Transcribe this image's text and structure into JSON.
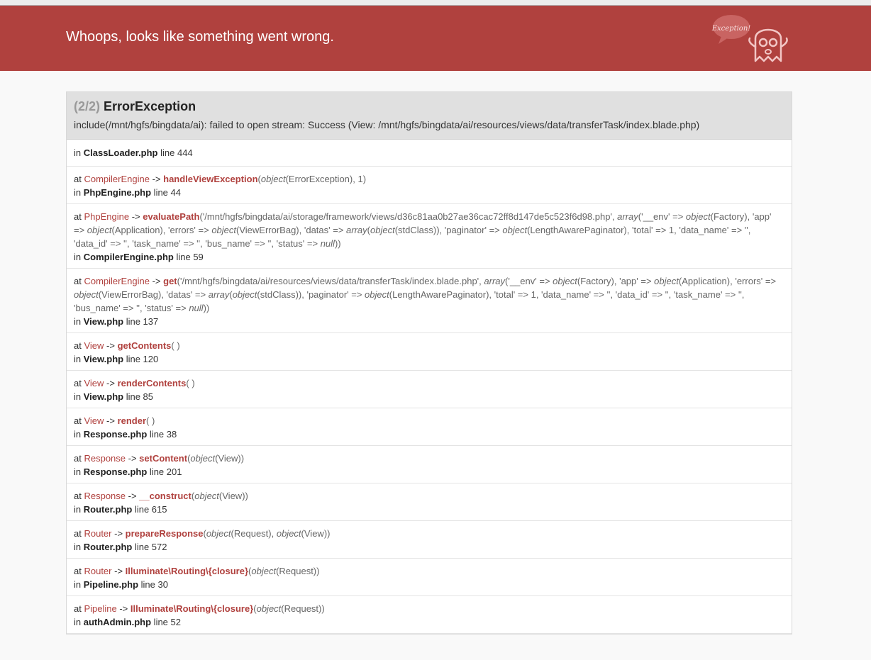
{
  "header": {
    "title": "Whoops, looks like something went wrong.",
    "logo_text": "Exception!"
  },
  "exception": {
    "count": "(2/2)",
    "name": "ErrorException",
    "message": "include(/mnt/hgfs/bingdata/ai): failed to open stream: Success (View: /mnt/hgfs/bingdata/ai/resources/views/data/transferTask/index.blade.php)"
  },
  "first_frame": {
    "prefix": "in",
    "file": "ClassLoader.php",
    "line_text": "line 444"
  },
  "frames": [
    {
      "class": "CompilerEngine",
      "method": "handleViewException",
      "args": [
        [
          "object",
          "(ErrorException)"
        ],
        [
          "",
          ", 1"
        ]
      ],
      "file": "PhpEngine.php",
      "line_text": "line 44"
    },
    {
      "class": "PhpEngine",
      "method": "evaluatePath",
      "args_html_key": "eval",
      "file": "CompilerEngine.php",
      "line_text": "line 59"
    },
    {
      "class": "CompilerEngine",
      "method": "get",
      "args_html_key": "get",
      "file": "View.php",
      "line_text": "line 137"
    },
    {
      "class": "View",
      "method": "getContents",
      "args": [],
      "file": "View.php",
      "line_text": "line 120"
    },
    {
      "class": "View",
      "method": "renderContents",
      "args": [],
      "file": "View.php",
      "line_text": "line 85"
    },
    {
      "class": "View",
      "method": "render",
      "args": [],
      "file": "Response.php",
      "line_text": "line 38"
    },
    {
      "class": "Response",
      "method": "setContent",
      "args": [
        [
          "object",
          "(View)"
        ]
      ],
      "file": "Response.php",
      "line_text": "line 201"
    },
    {
      "class": "Response",
      "method": "__construct",
      "args": [
        [
          "object",
          "(View)"
        ]
      ],
      "file": "Router.php",
      "line_text": "line 615"
    },
    {
      "class": "Router",
      "method": "prepareResponse",
      "args": [
        [
          "object",
          "(Request), "
        ],
        [
          "object",
          "(View)"
        ]
      ],
      "file": "Router.php",
      "line_text": "line 572"
    },
    {
      "class": "Router",
      "method": "Illuminate\\Routing\\{closure}",
      "args": [
        [
          "object",
          "(Request)"
        ]
      ],
      "file": "Pipeline.php",
      "line_text": "line 30"
    },
    {
      "class": "Pipeline",
      "method": "Illuminate\\Routing\\{closure}",
      "args": [
        [
          "object",
          "(Request)"
        ]
      ],
      "file": "authAdmin.php",
      "line_text": "line 52"
    }
  ],
  "long_args": {
    "eval": [
      [
        "",
        "'/mnt/hgfs/bingdata/ai/storage/framework/views/d36c81aa0b27ae36cac72ff8d147de5c523f6d98.php', "
      ],
      [
        "array",
        "('__env' => "
      ],
      [
        "object",
        "(Factory), 'app' => "
      ],
      [
        "object",
        "(Application), 'errors' => "
      ],
      [
        "object",
        "(ViewErrorBag), 'datas' => "
      ],
      [
        "array",
        "("
      ],
      [
        "object",
        "(stdClass)), 'paginator' => "
      ],
      [
        "object",
        "(LengthAwarePaginator), 'total' => 1, 'data_name' => '', 'data_id' => '', 'task_name' => '', 'bus_name' => '', 'status' => "
      ],
      [
        "null",
        ")"
      ]
    ],
    "get": [
      [
        "",
        "'/mnt/hgfs/bingdata/ai/resources/views/data/transferTask/index.blade.php', "
      ],
      [
        "array",
        "('__env' => "
      ],
      [
        "object",
        "(Factory), 'app' => "
      ],
      [
        "object",
        "(Application), 'errors' => "
      ],
      [
        "object",
        "(ViewErrorBag), 'datas' => "
      ],
      [
        "array",
        "("
      ],
      [
        "object",
        "(stdClass)), 'paginator' => "
      ],
      [
        "object",
        "(LengthAwarePaginator), 'total' => 1, 'data_name' => '', 'data_id' => '', 'task_name' => '', 'bus_name' => '', 'status' => "
      ],
      [
        "null",
        ")"
      ]
    ]
  },
  "labels": {
    "at": "at",
    "in": "in",
    "arrow": "->"
  },
  "colors": {
    "header_bg": "#b0413e",
    "accent": "#b0413e"
  }
}
